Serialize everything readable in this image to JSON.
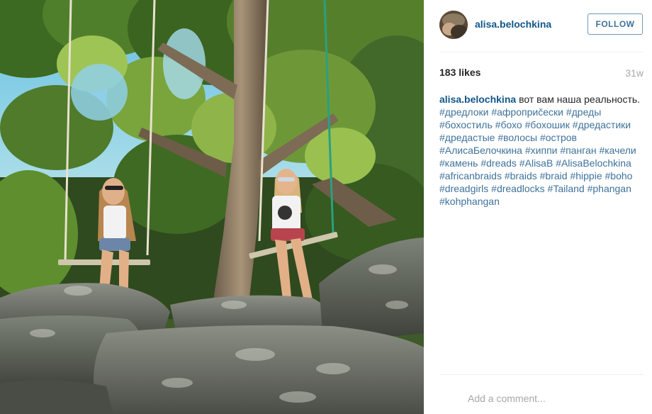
{
  "post": {
    "username": "alisa.belochkina",
    "follow_label": "FOLLOW",
    "likes": "183 likes",
    "age": "31w",
    "caption": {
      "author": "alisa.belochkina",
      "text": "вот вам наша реальность.",
      "hashtags": [
        "#дредлоки",
        "#афроприčески",
        "#дреды",
        "#бохостиль",
        "#бохо",
        "#бохошик",
        "#дредастики",
        "#дредастые",
        "#волосы",
        "#остров",
        "#АлисаБелочкина",
        "#хиппи",
        "#панган",
        "#качели",
        "#камень",
        "#dreads",
        "#AlisaB",
        "#AlisaBelochkina",
        "#africanbraids",
        "#braids",
        "#braid",
        "#hippie",
        "#boho",
        "#dreadgirls",
        "#dreadlocks",
        "#Tailand",
        "#phangan",
        "#kohphangan"
      ]
    },
    "comment_placeholder": "Add a comment..."
  },
  "colors": {
    "link": "#125688",
    "hashtag": "#3f729b",
    "muted": "#a5a7aa",
    "text": "#262626"
  }
}
